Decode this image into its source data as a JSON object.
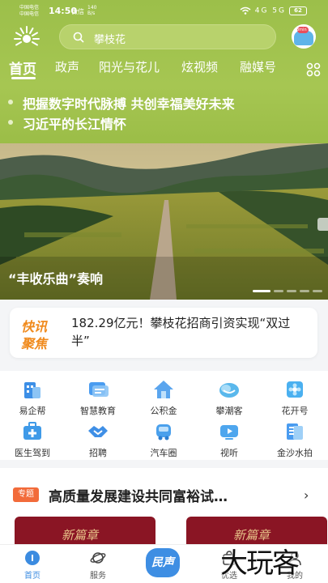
{
  "status_bar": {
    "carrier_1": "中国电信",
    "carrier_2": "中国电信",
    "time": "14:50",
    "extra": "微信",
    "speed_value": "140",
    "speed_unit": "B/s",
    "network": "4G 5G",
    "battery": "62"
  },
  "header": {
    "search_placeholder": "攀枝花",
    "avatar_tag": "3min"
  },
  "tabs": [
    {
      "label": "首页",
      "active": true
    },
    {
      "label": "政声",
      "active": false
    },
    {
      "label": "阳光与花儿",
      "active": false
    },
    {
      "label": "炫视频",
      "active": false
    },
    {
      "label": "融媒号",
      "active": false
    }
  ],
  "headlines": [
    "把握数字时代脉搏 共创幸福美好未来",
    "习近平的长江情怀"
  ],
  "hero": {
    "caption": "“丰收乐曲”奏响",
    "slide_count": 5,
    "active_slide": 1
  },
  "news_flash": {
    "logo_line_1": "快讯",
    "logo_line_2": "聚焦",
    "text": "182.29亿元！攀枝花招商引资实现“双过半”"
  },
  "services": [
    {
      "label": "易企帮",
      "icon": "building-icon",
      "color": "#3d8fe6"
    },
    {
      "label": "智慧教育",
      "icon": "book-icon",
      "color": "#4a9cf0"
    },
    {
      "label": "公积金",
      "icon": "house-icon",
      "color": "#5aa5ee"
    },
    {
      "label": "攀潮客",
      "icon": "cloud-icon",
      "color": "#5ab8ec"
    },
    {
      "label": "花开号",
      "icon": "flower-icon",
      "color": "#4ab0f0"
    },
    {
      "label": "医生驾到",
      "icon": "medical-kit-icon",
      "color": "#3f9ae8"
    },
    {
      "label": "招聘",
      "icon": "handshake-icon",
      "color": "#3f8fe6"
    },
    {
      "label": "汽车圈",
      "icon": "car-icon",
      "color": "#4aa0ec"
    },
    {
      "label": "视听",
      "icon": "tv-icon",
      "color": "#4ea6ee"
    },
    {
      "label": "金沙水拍",
      "icon": "document-icon",
      "color": "#4a9cf0"
    }
  ],
  "topic": {
    "badge": "专题",
    "title": "高质量发展建设共同富裕试…",
    "card_title": "新篇章"
  },
  "bottom_nav": [
    {
      "label": "首页",
      "icon": "home-icon",
      "active": true
    },
    {
      "label": "服务",
      "icon": "planet-icon",
      "active": false
    },
    {
      "label": "民声",
      "icon": "voice-icon",
      "active": false
    },
    {
      "label": "优选",
      "icon": "bag-icon",
      "active": false
    },
    {
      "label": "我的",
      "icon": "user-icon",
      "active": false
    }
  ],
  "watermark": "大玩客",
  "colors": {
    "header_green": "#a6c652",
    "accent_blue": "#3e8ee3",
    "flash_orange": "#f08a1c",
    "topic_red": "#f26b3a"
  }
}
